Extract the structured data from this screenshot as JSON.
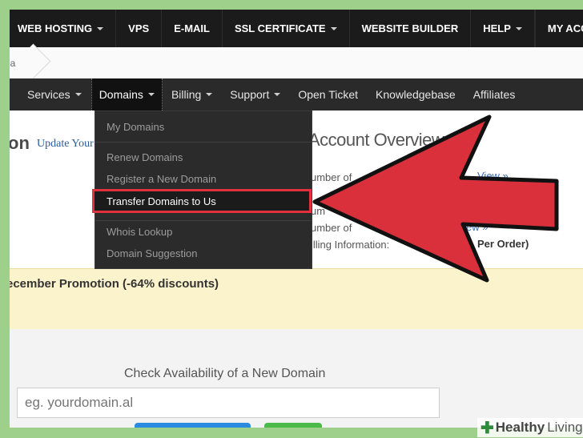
{
  "topnav": {
    "items": [
      "WEB HOSTING",
      "VPS",
      "E-MAIL",
      "SSL CERTIFICATE",
      "WEBSITE BUILDER",
      "HELP",
      "MY ACCOUN"
    ]
  },
  "breadcrumb": {
    "text": "ea"
  },
  "subnav": {
    "items": [
      "Services",
      "Domains",
      "Billing",
      "Support",
      "Open Ticket",
      "Knowledgebase",
      "Affiliates"
    ]
  },
  "dropdown": {
    "items": [
      "My Domains",
      "Renew Domains",
      "Register a New Domain",
      "Transfer Domains to Us",
      "Whois Lookup",
      "Domain Suggestion"
    ]
  },
  "header": {
    "title_fragment": "on",
    "update_link": "Update Your"
  },
  "account": {
    "title": "Account Overview",
    "lines": [
      "umber of",
      "um",
      "umber of",
      "illing Information:"
    ],
    "view1": "View »",
    "view2": "ew »",
    "per_order": "Per Order)"
  },
  "promo": {
    "text": "ecember Promotion (-64% discounts)"
  },
  "domain_search": {
    "title": "Check Availability of a New Domain",
    "placeholder": "eg. yourdomain.al"
  },
  "watermark": {
    "part1": "Healthy",
    "part2": "Living"
  },
  "colors": {
    "highlight": "#e0313f",
    "arrow": "#d9303c",
    "frame": "#9fd08b"
  }
}
